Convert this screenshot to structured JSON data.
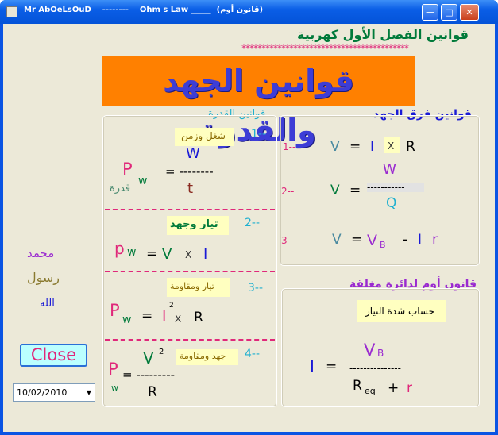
{
  "window": {
    "title": "Mr AbOeLsOuD    --------    Ohm s Law _____  (قانون أوم)",
    "minimize_glyph": "—",
    "maximize_glyph": "□",
    "close_glyph": "✕"
  },
  "header": {
    "chapter_title": "قوانين الفصل الأول كهربية",
    "stars": "******************************************",
    "banner": "قوانين الجهد والقدرة"
  },
  "power_panel": {
    "heading": "قوانين القدرة",
    "law1": {
      "num": "1--",
      "label": "شغل وزمن",
      "P": "P",
      "w": "w",
      "qodra": "قدرة",
      "eq": "= --------",
      "W": "W",
      "t": "t"
    },
    "law2": {
      "num": "2--",
      "label": "تيار وجهد",
      "p": "p",
      "w": "w",
      "eq": "=",
      "V": "V",
      "x": "X",
      "I": "I"
    },
    "law3": {
      "num": "3--",
      "label": "تيار ومقاومة",
      "P": "P",
      "w": "w",
      "eq": "=",
      "I": "I",
      "sq": "2",
      "x": "X",
      "R": "R"
    },
    "law4": {
      "num": "4--",
      "label": "جهد ومقاومة",
      "P": "P",
      "w": "w",
      "eq": "= ---------",
      "V": "V",
      "sq": "2",
      "R": "R"
    }
  },
  "voltage_panel": {
    "heading": "قوانين فرق الجهد",
    "law1": {
      "num": "1--",
      "V": "V",
      "eq": "=",
      "I": "I",
      "x": "X",
      "R": "R"
    },
    "law2": {
      "num": "2--",
      "V": "V",
      "eq": "=",
      "W": "W",
      "line": "-----------",
      "Q": "Q"
    },
    "law3": {
      "num": "3--",
      "V": "V",
      "eq": "=",
      "VB": "V",
      "B": "B",
      "minus": "-",
      "I": "I",
      "r": "r"
    }
  },
  "circuit_panel": {
    "heading": "قانون أوم لدائرة مغلقة",
    "label": "حساب شدة التيار",
    "I": "I",
    "eq": "=",
    "VB": "V",
    "B": "B",
    "line": "---------------",
    "R": "R",
    "eq_sub": "eq",
    "plus": "+",
    "r": "r"
  },
  "names": [
    "محمد",
    "رسول",
    "الله"
  ],
  "close_button": "Close",
  "date": "10/02/2010",
  "colors": {
    "pink": "#e0287a",
    "green": "#007a3a",
    "blue": "#1a1ad6",
    "purple": "#9a2ad0",
    "cyan": "#20b0d0",
    "olive": "#8a7a30"
  }
}
